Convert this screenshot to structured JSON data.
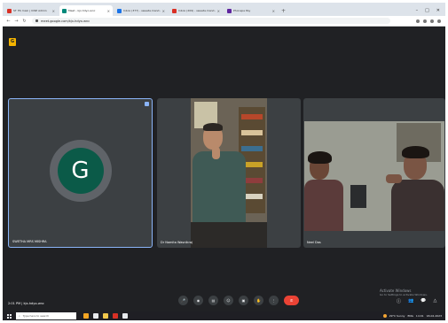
{
  "browser": {
    "tabs": [
      {
        "label": "ST HS main | IOSP Admin",
        "favicon_color": "#d93025",
        "active": false
      },
      {
        "label": "Meet - kjx-hdyo-wnc",
        "favicon_color": "#00897b",
        "active": true
      },
      {
        "label": "Inbox (377) - sweeta.mand...",
        "favicon_color": "#1a73e8",
        "active": false
      },
      {
        "label": "Inbox (209) - sweeta.mand...",
        "favicon_color": "#d93025",
        "active": false
      },
      {
        "label": "Phonepe Pay",
        "favicon_color": "#5f259f",
        "active": false
      }
    ],
    "new_tab": "+",
    "window_controls": {
      "minimize": "–",
      "maximize": "□",
      "close": "✕"
    },
    "url": "meet.google.com/kjx-hdyo-wnc",
    "nav": {
      "back": "←",
      "forward": "→",
      "reload": "↻"
    }
  },
  "meet": {
    "logo": "G",
    "participants": [
      {
        "name": "SWETHA MRS MISHRA",
        "initial": "G",
        "video": false,
        "avatar_color": "#0b5a48"
      },
      {
        "name": "Dr Namita Wasnikraj",
        "video": true
      },
      {
        "name": "Neel Das",
        "video": true
      }
    ],
    "time_meeting": "2:01 PM | kjx-hdyo-wnc",
    "controls": [
      "mic",
      "cam",
      "cc",
      "emoji",
      "present",
      "hand",
      "more"
    ],
    "control_glyphs": [
      "🎤",
      "◉",
      "▤",
      "☺",
      "▣",
      "✋",
      "⋮"
    ],
    "end_call_glyph": "✆",
    "right_controls": [
      "ⓘ",
      "👥",
      "💬",
      "△"
    ],
    "activate_windows": {
      "line1": "Activate Windows",
      "line2": "Go to Settings to activate Windows."
    }
  },
  "taskbar": {
    "search_placeholder": "Type here to search",
    "app_colors": [
      "#f5a623",
      "#e8eaed",
      "#f2c94c",
      "#d93025",
      "#e8eaed"
    ],
    "weather": "29°C Sunny",
    "tray_text": "ENG",
    "clock": "14:01",
    "date": "18-02-2023"
  }
}
